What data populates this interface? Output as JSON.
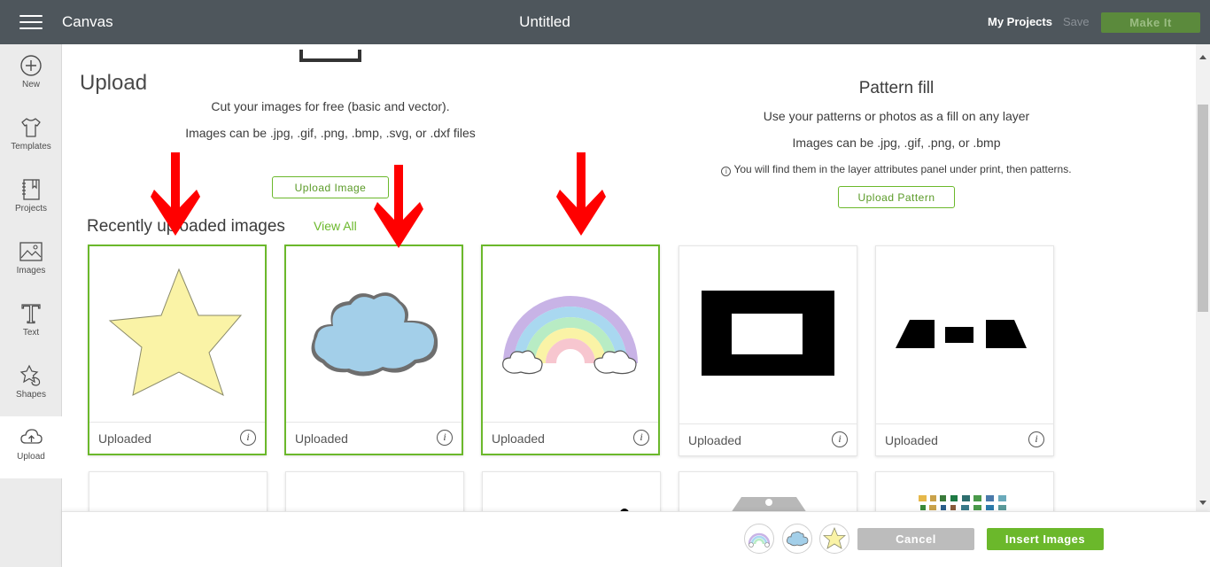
{
  "topbar": {
    "app_title": "Canvas",
    "doc_title": "Untitled",
    "my_projects": "My Projects",
    "save": "Save",
    "make_it": "Make It"
  },
  "sidebar": {
    "items": [
      {
        "label": "New",
        "icon": "plus-circle-icon"
      },
      {
        "label": "Templates",
        "icon": "tshirt-icon"
      },
      {
        "label": "Projects",
        "icon": "notebook-icon"
      },
      {
        "label": "Images",
        "icon": "image-icon"
      },
      {
        "label": "Text",
        "icon": "text-t-icon"
      },
      {
        "label": "Shapes",
        "icon": "shapes-icon"
      },
      {
        "label": "Upload",
        "icon": "cloud-upload-icon",
        "active": true
      }
    ]
  },
  "upload": {
    "title": "Upload",
    "desc1": "Cut your images for free (basic and vector).",
    "desc2": "Images can be .jpg, .gif, .png, .bmp, .svg, or .dxf files",
    "button": "Upload Image"
  },
  "pattern": {
    "title": "Pattern fill",
    "desc1": "Use your patterns or photos as a fill on any layer",
    "desc2": "Images can be .jpg, .gif, .png, or .bmp",
    "note": "You will find them in the layer attributes panel under print, then patterns.",
    "button": "Upload Pattern"
  },
  "recent": {
    "title": "Recently uploaded images",
    "view_all": "View All",
    "cards": [
      {
        "caption": "Uploaded",
        "image": "star",
        "selected": true
      },
      {
        "caption": "Uploaded",
        "image": "cloud",
        "selected": true
      },
      {
        "caption": "Uploaded",
        "image": "rainbow",
        "selected": true
      },
      {
        "caption": "Uploaded",
        "image": "black-frame",
        "selected": false
      },
      {
        "caption": "Uploaded",
        "image": "black-trapezoids",
        "selected": false
      }
    ]
  },
  "bottom": {
    "selected_thumbs": [
      "rainbow",
      "cloud",
      "star"
    ],
    "cancel": "Cancel",
    "insert": "Insert Images"
  },
  "colors": {
    "topbar": "#4e565c",
    "accent_green": "#6bb82b",
    "arrow_red": "#ff0000",
    "star_fill": "#faf3a6",
    "cloud_fill": "#a3cfe9"
  }
}
